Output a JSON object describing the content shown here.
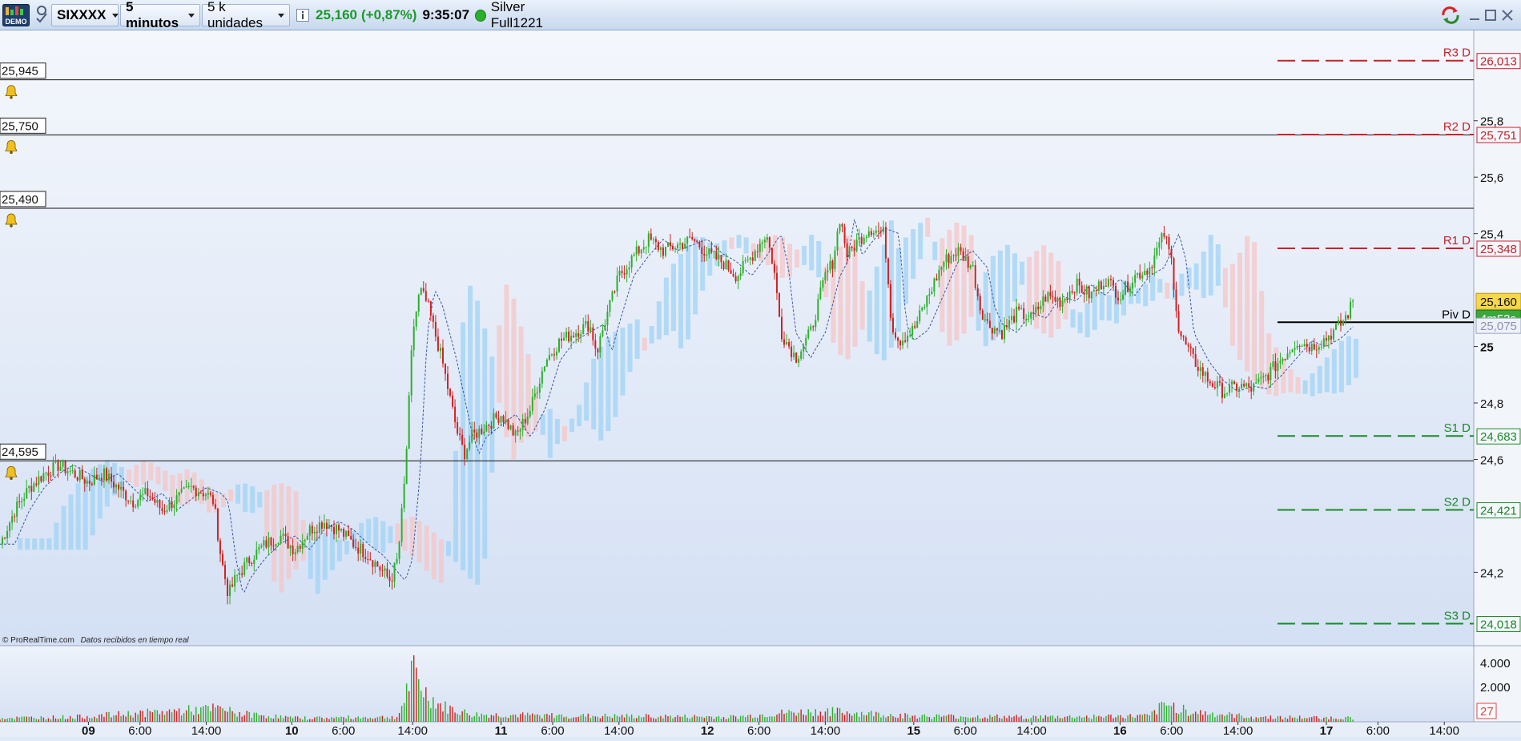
{
  "toolbar": {
    "demo_label": "DEMO",
    "symbol": "SIXXXX",
    "timeframe": "5 minutos",
    "units": "5 k unidades",
    "price": "25,160",
    "change": "(+0,87%)",
    "time": "9:35:07",
    "account": "Silver Full1221"
  },
  "footer": {
    "copyright": "© ProRealTime.com",
    "realtime": "Datos recibidos en tiempo real"
  },
  "chart_data": {
    "type": "candlestick",
    "ylim": [
      23.94,
      26.12
    ],
    "y_ticks": [
      "25,8",
      "25,6",
      "25,4",
      "25",
      "24,8",
      "24,6",
      "24,2"
    ],
    "y_tick_values": [
      25.8,
      25.6,
      25.4,
      25.0,
      24.8,
      24.6,
      24.2
    ],
    "x_labels": [
      "09",
      "6:00",
      "14:00",
      "10",
      "6:00",
      "14:00",
      "11",
      "6:00",
      "14:00",
      "12",
      "6:00",
      "14:00",
      "15",
      "6:00",
      "14:00",
      "16",
      "6:00",
      "14:00",
      "17",
      "6:00",
      "14:00"
    ],
    "x_bold": [
      true,
      false,
      false,
      true,
      false,
      false,
      true,
      false,
      false,
      true,
      false,
      false,
      true,
      false,
      false,
      true,
      false,
      false,
      true,
      false,
      false
    ],
    "x_positions": [
      0.06,
      0.095,
      0.14,
      0.198,
      0.233,
      0.28,
      0.34,
      0.375,
      0.42,
      0.48,
      0.515,
      0.56,
      0.62,
      0.655,
      0.7,
      0.76,
      0.795,
      0.84,
      0.9,
      0.935,
      0.98
    ],
    "price_path": [
      [
        0,
        24.3
      ],
      [
        0.01,
        24.42
      ],
      [
        0.02,
        24.5
      ],
      [
        0.03,
        24.55
      ],
      [
        0.04,
        24.58
      ],
      [
        0.05,
        24.55
      ],
      [
        0.06,
        24.52
      ],
      [
        0.07,
        24.55
      ],
      [
        0.08,
        24.5
      ],
      [
        0.09,
        24.45
      ],
      [
        0.1,
        24.48
      ],
      [
        0.11,
        24.42
      ],
      [
        0.12,
        24.46
      ],
      [
        0.13,
        24.5
      ],
      [
        0.14,
        24.48
      ],
      [
        0.145,
        24.45
      ],
      [
        0.15,
        24.25
      ],
      [
        0.155,
        24.12
      ],
      [
        0.16,
        24.18
      ],
      [
        0.17,
        24.25
      ],
      [
        0.18,
        24.3
      ],
      [
        0.19,
        24.33
      ],
      [
        0.2,
        24.28
      ],
      [
        0.21,
        24.35
      ],
      [
        0.22,
        24.38
      ],
      [
        0.23,
        24.35
      ],
      [
        0.24,
        24.3
      ],
      [
        0.25,
        24.26
      ],
      [
        0.26,
        24.2
      ],
      [
        0.265,
        24.17
      ],
      [
        0.27,
        24.25
      ],
      [
        0.275,
        24.55
      ],
      [
        0.28,
        25.05
      ],
      [
        0.285,
        25.2
      ],
      [
        0.29,
        25.15
      ],
      [
        0.3,
        24.95
      ],
      [
        0.31,
        24.7
      ],
      [
        0.315,
        24.62
      ],
      [
        0.32,
        24.68
      ],
      [
        0.33,
        24.72
      ],
      [
        0.34,
        24.76
      ],
      [
        0.35,
        24.68
      ],
      [
        0.36,
        24.78
      ],
      [
        0.37,
        24.95
      ],
      [
        0.38,
        25.02
      ],
      [
        0.39,
        25.05
      ],
      [
        0.4,
        25.08
      ],
      [
        0.405,
        24.98
      ],
      [
        0.41,
        25.08
      ],
      [
        0.42,
        25.25
      ],
      [
        0.43,
        25.32
      ],
      [
        0.44,
        25.38
      ],
      [
        0.45,
        25.34
      ],
      [
        0.46,
        25.36
      ],
      [
        0.47,
        25.38
      ],
      [
        0.48,
        25.33
      ],
      [
        0.49,
        25.3
      ],
      [
        0.5,
        25.25
      ],
      [
        0.51,
        25.32
      ],
      [
        0.52,
        25.4
      ],
      [
        0.525,
        25.28
      ],
      [
        0.53,
        25.05
      ],
      [
        0.54,
        24.96
      ],
      [
        0.55,
        25.05
      ],
      [
        0.56,
        25.25
      ],
      [
        0.565,
        25.3
      ],
      [
        0.57,
        25.46
      ],
      [
        0.575,
        25.32
      ],
      [
        0.58,
        25.36
      ],
      [
        0.59,
        25.42
      ],
      [
        0.6,
        25.4
      ],
      [
        0.605,
        25.08
      ],
      [
        0.61,
        25.02
      ],
      [
        0.62,
        25.06
      ],
      [
        0.63,
        25.18
      ],
      [
        0.64,
        25.3
      ],
      [
        0.65,
        25.34
      ],
      [
        0.66,
        25.28
      ],
      [
        0.665,
        25.14
      ],
      [
        0.67,
        25.08
      ],
      [
        0.68,
        25.05
      ],
      [
        0.69,
        25.12
      ],
      [
        0.7,
        25.1
      ],
      [
        0.71,
        25.18
      ],
      [
        0.72,
        25.16
      ],
      [
        0.73,
        25.22
      ],
      [
        0.74,
        25.18
      ],
      [
        0.75,
        25.24
      ],
      [
        0.76,
        25.18
      ],
      [
        0.77,
        25.25
      ],
      [
        0.78,
        25.28
      ],
      [
        0.79,
        25.4
      ],
      [
        0.795,
        25.3
      ],
      [
        0.8,
        25.05
      ],
      [
        0.81,
        24.95
      ],
      [
        0.82,
        24.88
      ],
      [
        0.83,
        24.84
      ],
      [
        0.84,
        24.86
      ],
      [
        0.85,
        24.85
      ],
      [
        0.86,
        24.9
      ],
      [
        0.87,
        24.96
      ],
      [
        0.88,
        25.02
      ],
      [
        0.89,
        25.0
      ],
      [
        0.9,
        25.03
      ],
      [
        0.91,
        25.08
      ],
      [
        0.915,
        25.12
      ],
      [
        0.918,
        25.16
      ]
    ],
    "volume_profile": [
      [
        0,
        0.08
      ],
      [
        0.05,
        0.1
      ],
      [
        0.15,
        0.28
      ],
      [
        0.16,
        0.18
      ],
      [
        0.2,
        0.08
      ],
      [
        0.27,
        0.1
      ],
      [
        0.28,
        1.0
      ],
      [
        0.29,
        0.55
      ],
      [
        0.3,
        0.32
      ],
      [
        0.32,
        0.15
      ],
      [
        0.4,
        0.12
      ],
      [
        0.5,
        0.1
      ],
      [
        0.53,
        0.18
      ],
      [
        0.56,
        0.22
      ],
      [
        0.62,
        0.12
      ],
      [
        0.7,
        0.1
      ],
      [
        0.78,
        0.12
      ],
      [
        0.79,
        0.35
      ],
      [
        0.8,
        0.3
      ],
      [
        0.81,
        0.2
      ],
      [
        0.85,
        0.1
      ],
      [
        0.918,
        0.08
      ]
    ],
    "volume_ticks": [
      "4.000",
      "2.000"
    ],
    "volume_current": "27",
    "alert_lines": [
      {
        "value": 25.945,
        "label": "25,945"
      },
      {
        "value": 25.75,
        "label": "25,750"
      },
      {
        "value": 25.49,
        "label": "25,490"
      },
      {
        "value": 24.595,
        "label": "24,595"
      }
    ],
    "pivot_levels": [
      {
        "name": "R3 D",
        "value": 26.013,
        "label": "26,013",
        "color": "#c8202a"
      },
      {
        "name": "R2 D",
        "value": 25.751,
        "label": "25,751",
        "color": "#c8202a"
      },
      {
        "name": "R1 D",
        "value": 25.348,
        "label": "25,348",
        "color": "#c8202a"
      },
      {
        "name": "Piv D",
        "value": 25.086,
        "label": "25,086",
        "color": "#000000"
      },
      {
        "name": "S1 D",
        "value": 24.683,
        "label": "24,683",
        "color": "#1a8a2a"
      },
      {
        "name": "S2 D",
        "value": 24.421,
        "label": "24,421",
        "color": "#1a8a2a"
      },
      {
        "name": "S3 D",
        "value": 24.018,
        "label": "24,018",
        "color": "#1a8a2a"
      }
    ],
    "current_price": {
      "value": 25.16,
      "label": "25,160"
    },
    "countdown": "4m53s",
    "secondary_value": {
      "value": 25.075,
      "label": "25,075"
    },
    "colors": {
      "up": "#2bb02b",
      "down": "#d42020",
      "cloud_up": "#9fd3f5",
      "cloud_down": "#f5c6c6",
      "price_badge": "#f6d84a",
      "timer_badge": "#3aa83a"
    }
  }
}
